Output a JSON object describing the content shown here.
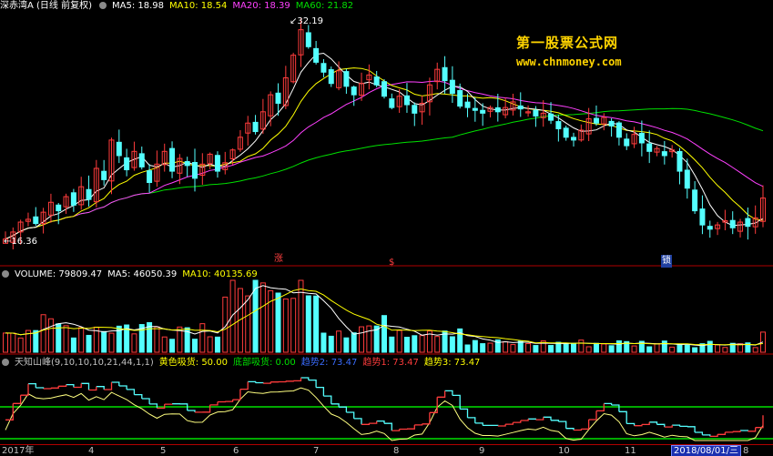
{
  "price_panel": {
    "title": "深赤湾A (日线 前复权)",
    "ma5": "MA5: 18.98",
    "ma10": "MA10: 18.54",
    "ma20": "MA20: 18.39",
    "ma60": "MA60: 21.82",
    "high_label": "32.19",
    "low_label": "16.36",
    "markers": [
      "涨",
      "$",
      "锁"
    ]
  },
  "volume_panel": {
    "title": "VOLUME: 79809.47",
    "ma5": "MA5: 46050.39",
    "ma10": "MA10: 40135.69"
  },
  "indicator_panel": {
    "title": "天知山峰(9,10,10,10,21,44,1,1)",
    "yellow": "黄色吸货: 50.00",
    "bottom": "底部吸货: 0.00",
    "trend2": "趋势2: 73.47",
    "trend1": "趋势1: 73.47",
    "trend3": "趋势3: 73.47"
  },
  "watermark": {
    "line1": "第一股票公式网",
    "line2": "www.chnmoney.com"
  },
  "x_axis": {
    "labels": [
      "2017年",
      "4",
      "5",
      "6",
      "7",
      "8",
      "9",
      "10",
      "11",
      "8"
    ],
    "cursor_date": "2018/08/01/三"
  },
  "colors": {
    "up": "#ff3c3c",
    "down": "#54ffff",
    "ma5": "#ffffff",
    "ma10": "#ffff00",
    "ma20": "#ff40ff",
    "ma60": "#00e000",
    "axis": "#b00000"
  },
  "chart_data": [
    {
      "type": "candlestick",
      "name": "price",
      "y_range": [
        16.36,
        32.19
      ],
      "closes": [
        16.6,
        17.1,
        17.8,
        18.0,
        17.7,
        18.5,
        19.2,
        18.6,
        19.6,
        19.0,
        20.3,
        19.4,
        21.6,
        20.8,
        23.6,
        22.5,
        21.5,
        22.8,
        21.7,
        20.6,
        21.9,
        22.8,
        21.4,
        22.3,
        21.8,
        20.9,
        21.9,
        22.6,
        21.4,
        22.0,
        22.9,
        23.8,
        24.8,
        24.2,
        25.6,
        26.8,
        26.2,
        28.0,
        29.6,
        31.4,
        30.2,
        29.1,
        28.4,
        27.6,
        28.5,
        27.4,
        26.8,
        27.6,
        28.2,
        27.5,
        26.7,
        25.9,
        26.7,
        26.1,
        25.5,
        26.2,
        27.5,
        28.6,
        27.8,
        26.9,
        26.0,
        25.9,
        25.7,
        25.5,
        25.9,
        25.6,
        25.9,
        26.3,
        25.8,
        25.6,
        25.3,
        25.5,
        25.0,
        24.4,
        23.8,
        23.6,
        24.3,
        25.1,
        24.8,
        25.2,
        24.6,
        23.8,
        23.2,
        24.0,
        23.4,
        22.8,
        23.0,
        22.5,
        22.9,
        21.4,
        20.2,
        18.6,
        17.6,
        17.3,
        17.6,
        17.9,
        17.4,
        17.8,
        17.5,
        18.1,
        19.5
      ]
    },
    {
      "type": "bar",
      "name": "volume",
      "values": []
    },
    {
      "type": "line",
      "name": "天知山峰",
      "series": [
        {
          "name": "趋势1",
          "values": []
        },
        {
          "name": "趋势2",
          "values": []
        },
        {
          "name": "趋势3",
          "values": []
        }
      ]
    }
  ]
}
